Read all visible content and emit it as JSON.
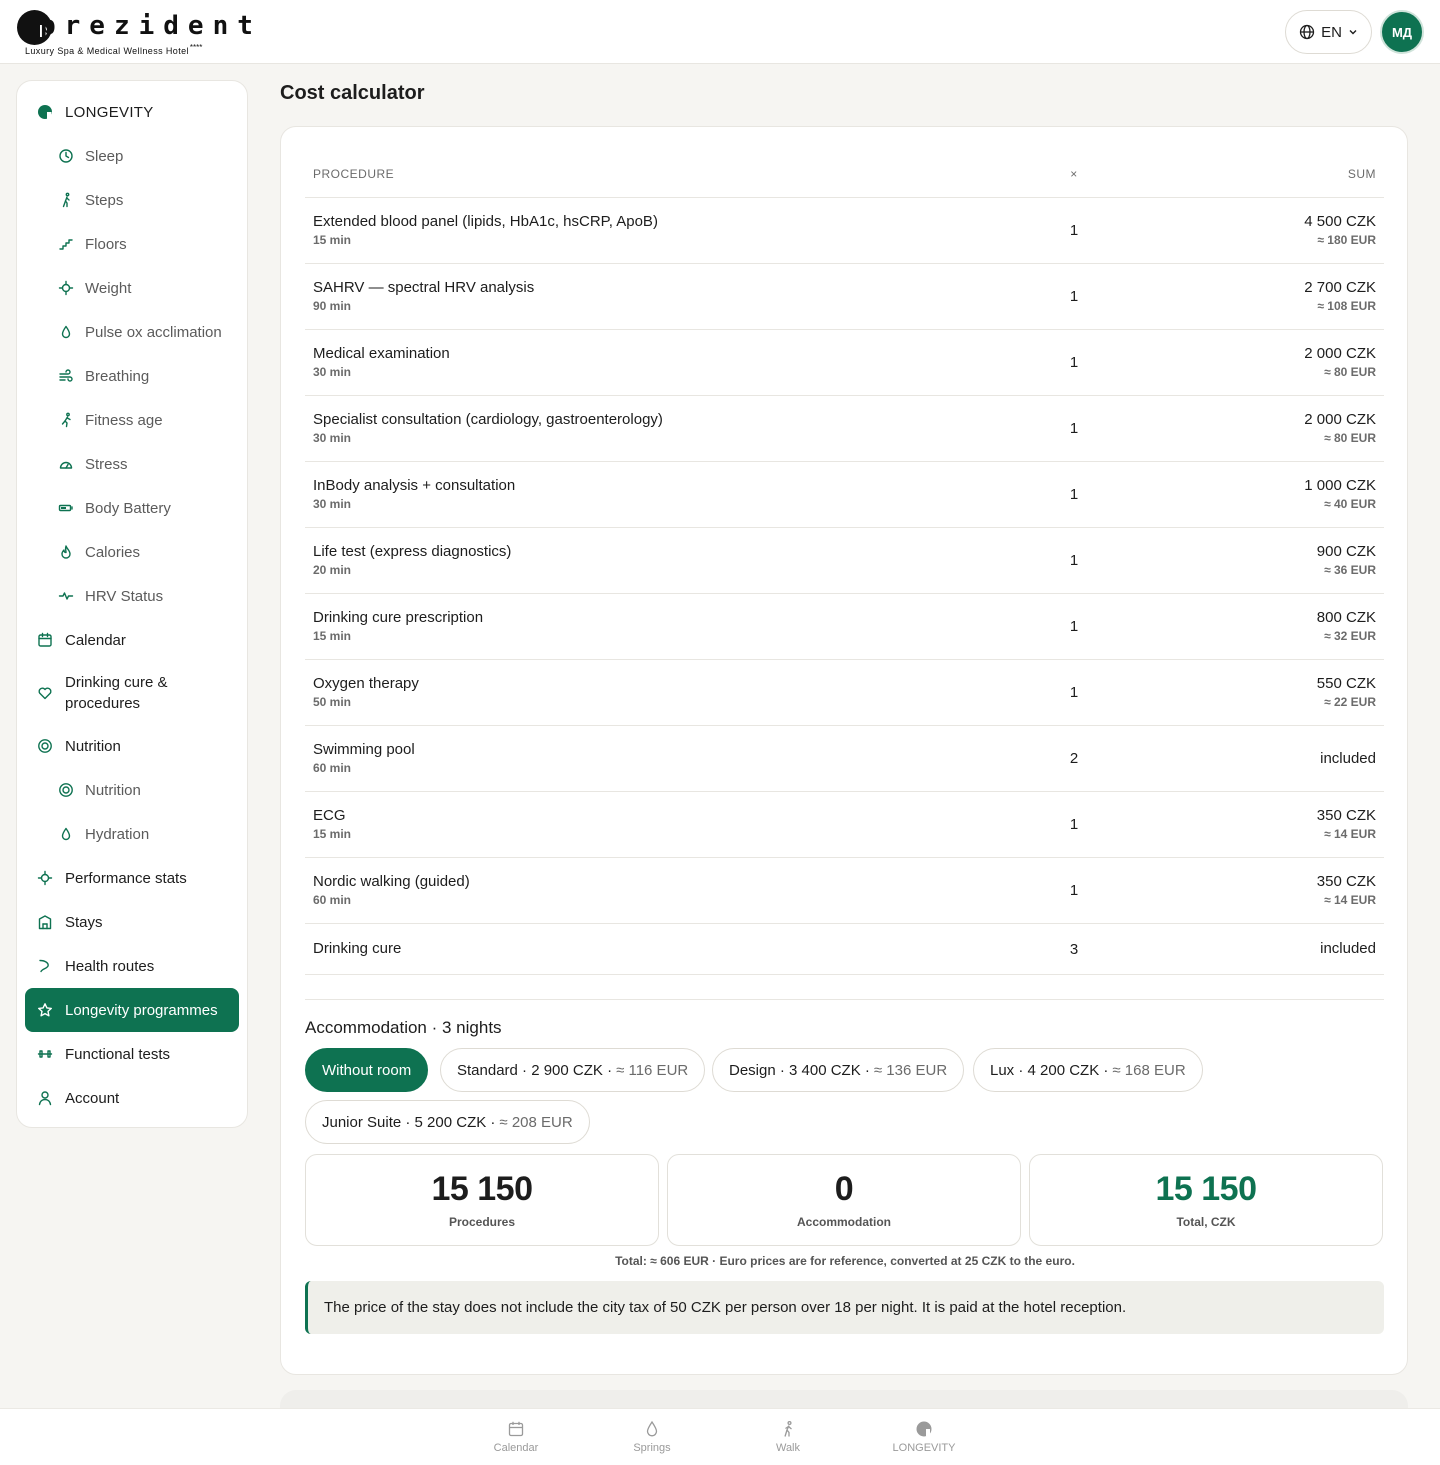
{
  "header": {
    "logo_word": "prezident",
    "logo_sub": "Luxury Spa & Medical Wellness Hotel",
    "logo_stars": "****",
    "lang": "EN",
    "avatar": "МД"
  },
  "sidebar": {
    "items": [
      {
        "label": "LONGEVITY",
        "icon": "longevity-icon"
      },
      {
        "label": "Sleep",
        "icon": "clock-icon"
      },
      {
        "label": "Steps",
        "icon": "walk-icon"
      },
      {
        "label": "Floors",
        "icon": "stairs-icon"
      },
      {
        "label": "Weight",
        "icon": "crosshair-icon"
      },
      {
        "label": "Pulse ox acclimation",
        "icon": "drop-icon"
      },
      {
        "label": "Breathing",
        "icon": "wind-icon"
      },
      {
        "label": "Fitness age",
        "icon": "run-icon"
      },
      {
        "label": "Stress",
        "icon": "gauge-icon"
      },
      {
        "label": "Body Battery",
        "icon": "battery-icon"
      },
      {
        "label": "Calories",
        "icon": "flame-icon"
      },
      {
        "label": "HRV Status",
        "icon": "pulse-icon"
      },
      {
        "label": "Calendar",
        "icon": "calendar-icon"
      },
      {
        "label": "Drinking cure & procedures",
        "icon": "heart-icon"
      },
      {
        "label": "Nutrition",
        "icon": "target-icon"
      },
      {
        "label": "Nutrition",
        "icon": "target-icon"
      },
      {
        "label": "Hydration",
        "icon": "drop-icon"
      },
      {
        "label": "Performance stats",
        "icon": "crosshair-icon"
      },
      {
        "label": "Stays",
        "icon": "building-icon"
      },
      {
        "label": "Health routes",
        "icon": "route-icon"
      },
      {
        "label": "Longevity programmes",
        "icon": "star-icon"
      },
      {
        "label": "Functional tests",
        "icon": "dumbbell-icon"
      },
      {
        "label": "Account",
        "icon": "user-icon"
      }
    ]
  },
  "main": {
    "title": "Cost calculator",
    "table": {
      "headers": {
        "procedure": "PROCEDURE",
        "qty": "×",
        "sum": "SUM"
      },
      "rows": [
        {
          "name": "Extended blood panel (lipids, HbA1c, hsCRP, ApoB)",
          "duration": "15 min",
          "qty": "1",
          "czk": "4 500 CZK",
          "eur": "≈ 180 EUR"
        },
        {
          "name": "SAHRV — spectral HRV analysis",
          "duration": "90 min",
          "qty": "1",
          "czk": "2 700 CZK",
          "eur": "≈ 108 EUR"
        },
        {
          "name": "Medical examination",
          "duration": "30 min",
          "qty": "1",
          "czk": "2 000 CZK",
          "eur": "≈ 80 EUR"
        },
        {
          "name": "Specialist consultation (cardiology, gastroenterology)",
          "duration": "30 min",
          "qty": "1",
          "czk": "2 000 CZK",
          "eur": "≈ 80 EUR"
        },
        {
          "name": "InBody analysis + consultation",
          "duration": "30 min",
          "qty": "1",
          "czk": "1 000 CZK",
          "eur": "≈ 40 EUR"
        },
        {
          "name": "Life test (express diagnostics)",
          "duration": "20 min",
          "qty": "1",
          "czk": "900 CZK",
          "eur": "≈ 36 EUR"
        },
        {
          "name": "Drinking cure prescription",
          "duration": "15 min",
          "qty": "1",
          "czk": "800 CZK",
          "eur": "≈ 32 EUR"
        },
        {
          "name": "Oxygen therapy",
          "duration": "50 min",
          "qty": "1",
          "czk": "550 CZK",
          "eur": "≈ 22 EUR"
        },
        {
          "name": "Swimming pool",
          "duration": "60 min",
          "qty": "2",
          "czk": "included",
          "eur": ""
        },
        {
          "name": "ECG",
          "duration": "15 min",
          "qty": "1",
          "czk": "350 CZK",
          "eur": "≈ 14 EUR"
        },
        {
          "name": "Nordic walking (guided)",
          "duration": "60 min",
          "qty": "1",
          "czk": "350 CZK",
          "eur": "≈ 14 EUR"
        },
        {
          "name": "Drinking cure",
          "duration": "",
          "qty": "3",
          "czk": "included",
          "eur": ""
        }
      ]
    },
    "accommodation": {
      "title": "Accommodation · 3 nights",
      "options": [
        {
          "label": "Without room",
          "eur": ""
        },
        {
          "label": "Standard · 2 900 CZK ·",
          "eur": "≈ 116 EUR"
        },
        {
          "label": "Design · 3 400 CZK ·",
          "eur": "≈ 136 EUR"
        },
        {
          "label": "Lux · 4 200 CZK ·",
          "eur": "≈ 168 EUR"
        },
        {
          "label": "Junior Suite · 5 200 CZK ·",
          "eur": "≈ 208 EUR"
        }
      ],
      "selected": "Without room"
    },
    "stats": [
      {
        "value": "15 150",
        "label": "Procedures"
      },
      {
        "value": "0",
        "label": "Accommodation"
      },
      {
        "value": "15 150",
        "label": "Total, CZK"
      }
    ],
    "note": "Total: ≈ 606 EUR · Euro prices are for reference, converted at 25 CZK to the euro.",
    "info": "The price of the stay does not include the city tax of 50 CZK per person over 18 per night. It is paid at the hotel reception."
  },
  "bottom_nav": [
    {
      "label": "Calendar",
      "icon": "calendar-icon"
    },
    {
      "label": "Springs",
      "icon": "drop-icon"
    },
    {
      "label": "Walk",
      "icon": "walk-icon"
    },
    {
      "label": "LONGEVITY",
      "icon": "longevity-icon"
    }
  ],
  "colors": {
    "accent": "#0e7251",
    "background": "#f6f5f2"
  }
}
